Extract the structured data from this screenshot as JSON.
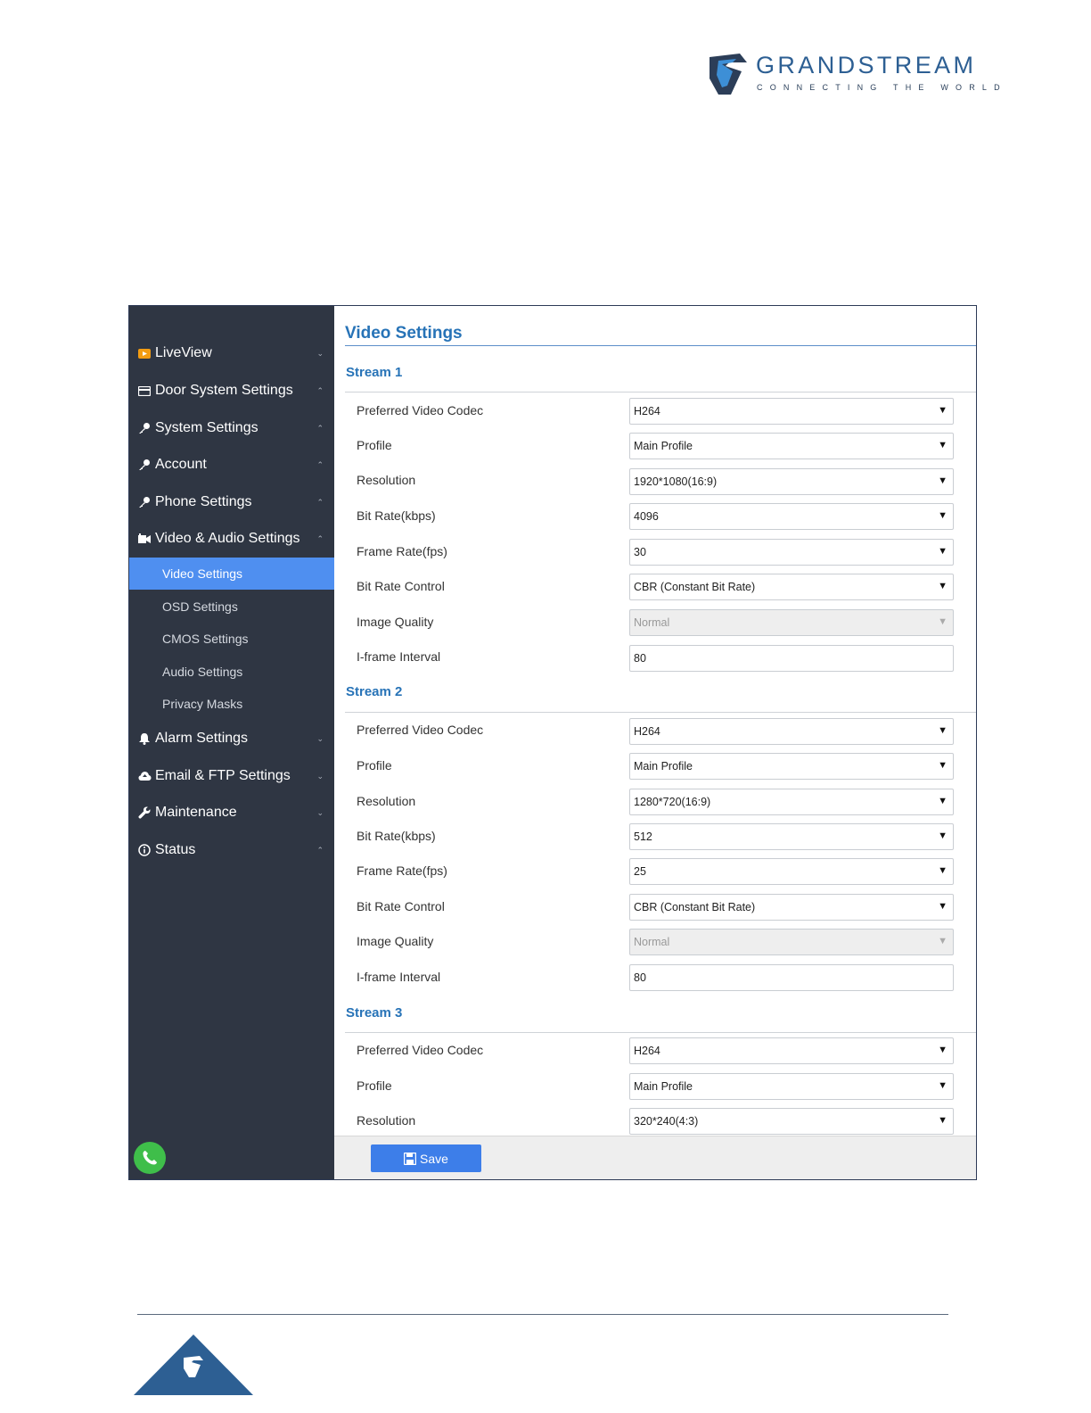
{
  "brand": {
    "name": "GRANDSTREAM",
    "tagline": "CONNECTING THE WORLD"
  },
  "sidebar": {
    "items": [
      {
        "label": "LiveView",
        "icon": "camera-icon",
        "caret": "⌄"
      },
      {
        "label": "Door System Settings",
        "icon": "door-card-icon",
        "caret": "⌃"
      },
      {
        "label": "System Settings",
        "icon": "key-icon",
        "caret": "⌃"
      },
      {
        "label": "Account",
        "icon": "key-icon",
        "caret": "⌃"
      },
      {
        "label": "Phone Settings",
        "icon": "key-icon",
        "caret": "⌃"
      },
      {
        "label": "Video & Audio Settings",
        "icon": "video-audio-icon",
        "caret": "⌃"
      },
      {
        "label": "Alarm Settings",
        "icon": "bell-icon",
        "caret": "⌄"
      },
      {
        "label": "Email & FTP Settings",
        "icon": "cloud-icon",
        "caret": "⌄"
      },
      {
        "label": "Maintenance",
        "icon": "wrench-icon",
        "caret": "⌄"
      },
      {
        "label": "Status",
        "icon": "info-icon",
        "caret": "⌃"
      }
    ],
    "subitems": [
      {
        "label": "Video Settings",
        "active": true
      },
      {
        "label": "OSD Settings"
      },
      {
        "label": "CMOS Settings"
      },
      {
        "label": "Audio Settings"
      },
      {
        "label": "Privacy Masks"
      }
    ]
  },
  "main": {
    "title": "Video Settings",
    "streams": [
      {
        "header": "Stream 1",
        "rows": [
          {
            "label": "Preferred Video Codec",
            "value": "H264",
            "type": "select"
          },
          {
            "label": "Profile",
            "value": "Main Profile",
            "type": "select"
          },
          {
            "label": "Resolution",
            "value": "1920*1080(16:9)",
            "type": "select"
          },
          {
            "label": "Bit Rate(kbps)",
            "value": "4096",
            "type": "select"
          },
          {
            "label": "Frame Rate(fps)",
            "value": "30",
            "type": "select"
          },
          {
            "label": "Bit Rate Control",
            "value": "CBR (Constant Bit Rate)",
            "type": "select"
          },
          {
            "label": "Image Quality",
            "value": "Normal",
            "type": "select-disabled"
          },
          {
            "label": "I-frame Interval",
            "value": "80",
            "type": "text"
          }
        ]
      },
      {
        "header": "Stream 2",
        "rows": [
          {
            "label": "Preferred Video Codec",
            "value": "H264",
            "type": "select"
          },
          {
            "label": "Profile",
            "value": "Main Profile",
            "type": "select"
          },
          {
            "label": "Resolution",
            "value": "1280*720(16:9)",
            "type": "select"
          },
          {
            "label": "Bit Rate(kbps)",
            "value": "512",
            "type": "select"
          },
          {
            "label": "Frame Rate(fps)",
            "value": "25",
            "type": "select"
          },
          {
            "label": "Bit Rate Control",
            "value": "CBR (Constant Bit Rate)",
            "type": "select"
          },
          {
            "label": "Image Quality",
            "value": "Normal",
            "type": "select-disabled"
          },
          {
            "label": "I-frame Interval",
            "value": "80",
            "type": "text"
          }
        ]
      },
      {
        "header": "Stream 3",
        "rows": [
          {
            "label": "Preferred Video Codec",
            "value": "H264",
            "type": "select"
          },
          {
            "label": "Profile",
            "value": "Main Profile",
            "type": "select"
          },
          {
            "label": "Resolution",
            "value": "320*240(4:3)",
            "type": "select"
          }
        ]
      }
    ],
    "save_label": "Save"
  },
  "colors": {
    "sidebar_bg": "#2f3643",
    "active_item": "#4f8ff0",
    "title_blue": "#2773b7",
    "save_button": "#3d7ee9",
    "brand_blue": "#2d5f93"
  }
}
